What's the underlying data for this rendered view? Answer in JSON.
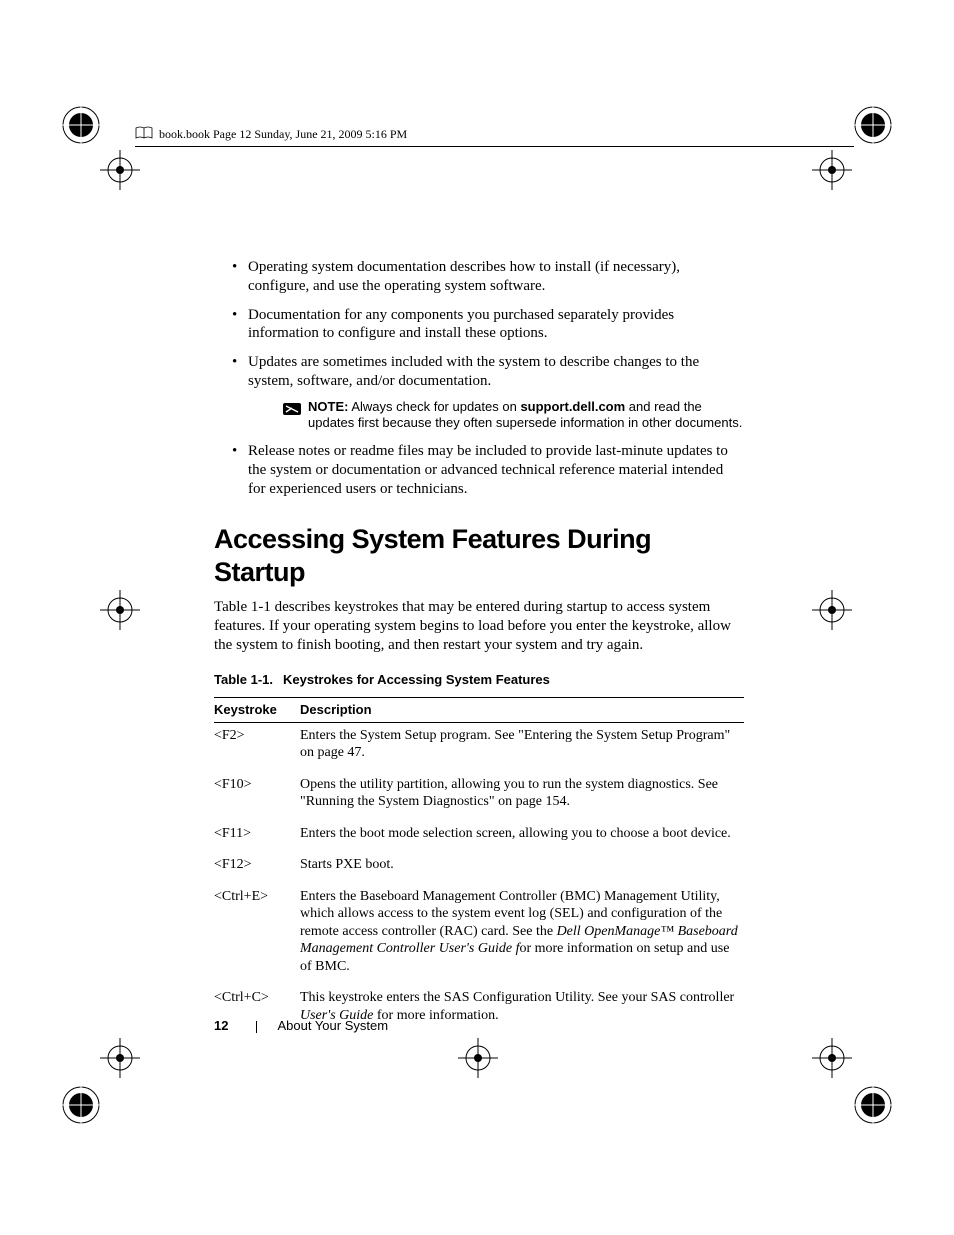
{
  "header": {
    "runningHead": "book.book  Page 12  Sunday, June 21, 2009  5:16 PM"
  },
  "bullets": {
    "b1": "Operating system documentation describes how to install (if necessary), configure, and use the operating system software.",
    "b2": "Documentation for any components you purchased separately provides information to configure and install these options.",
    "b3": "Updates are sometimes included with the system to describe changes to the system, software, and/or documentation.",
    "b4": "Release notes or readme files may be included to provide last-minute updates to the system or documentation or advanced technical reference material intended for experienced users or technicians."
  },
  "note": {
    "label": "NOTE:",
    "pre": " Always check for updates on ",
    "site": "support.dell.com",
    "post": " and read the updates first because they often supersede information in other documents."
  },
  "section": {
    "heading": "Accessing System Features During Startup",
    "intro": "Table 1-1 describes keystrokes that may be entered during startup to access system features. If your operating system begins to load before you enter the keystroke, allow the system to finish booting, and then restart your system and try again."
  },
  "table": {
    "captionNum": "Table 1-1.",
    "captionText": "Keystrokes for Accessing System Features",
    "headKey": "Keystroke",
    "headDesc": "Description",
    "rows": [
      {
        "key": "<F2>",
        "desc": "Enters the System Setup program. See \"Entering the System Setup Program\" on page 47."
      },
      {
        "key": "<F10>",
        "desc": "Opens the utility partition, allowing you to run the system diagnostics. See \"Running the System Diagnostics\" on page 154."
      },
      {
        "key": "<F11>",
        "desc": "Enters the boot mode selection screen, allowing you to choose a boot device."
      },
      {
        "key": "<F12>",
        "desc": "Starts PXE boot."
      }
    ],
    "rowCtrlE": {
      "key": "<Ctrl+E>",
      "pre": "Enters the Baseboard Management Controller (BMC) Management Utility, which allows access to the system event log (SEL) and configuration of the remote access controller (RAC) card. See the ",
      "italic": "Dell OpenManage™ Baseboard Management Controller User's Guide f",
      "post": "or more information on setup and use of BMC."
    },
    "rowCtrlC": {
      "key": "<Ctrl+C>",
      "pre": "This keystroke enters the SAS Configuration Utility. See your SAS controller ",
      "italic": "User's Guide",
      "post": " for more information."
    }
  },
  "footer": {
    "pageNumber": "12",
    "section": "About Your System"
  }
}
